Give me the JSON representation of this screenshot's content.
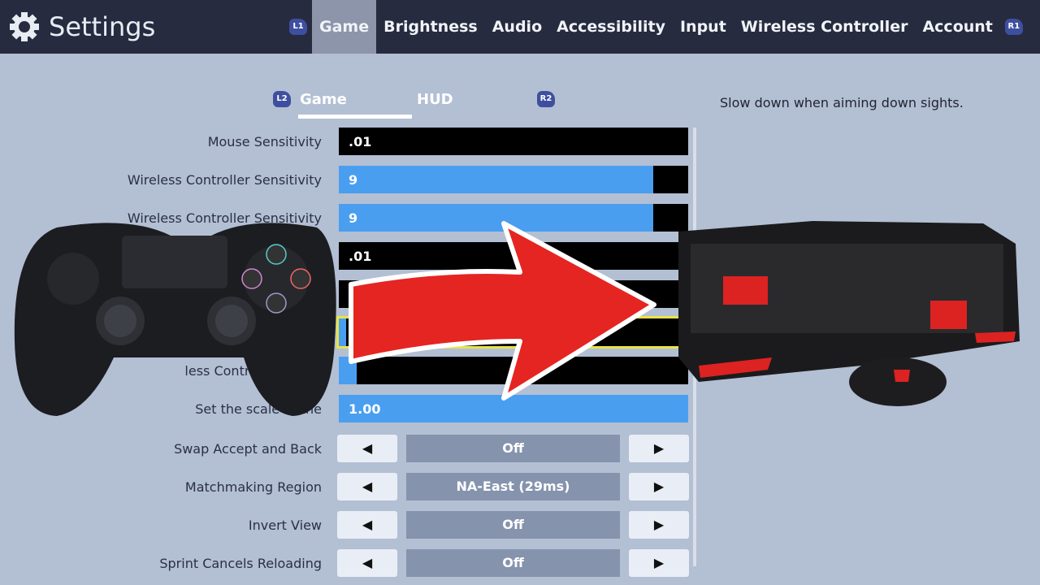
{
  "header": {
    "title": "Settings",
    "left_badge": "L1",
    "right_badge": "R1",
    "tabs": [
      {
        "label": "Game",
        "active": true
      },
      {
        "label": "Brightness"
      },
      {
        "label": "Audio"
      },
      {
        "label": "Accessibility"
      },
      {
        "label": "Input"
      },
      {
        "label": "Wireless Controller"
      },
      {
        "label": "Account"
      }
    ]
  },
  "subtabs": {
    "left_badge": "L2",
    "right_badge": "R2",
    "items": [
      {
        "label": "Game",
        "active": true
      },
      {
        "label": "HUD"
      }
    ]
  },
  "description": "Slow down when aiming down sights.",
  "rows": [
    {
      "label": "Mouse Sensitivity",
      "value": ".01",
      "fill": 0
    },
    {
      "label": "Wireless Controller Sensitivity",
      "value": "9",
      "fill": 0.9
    },
    {
      "label": "Wireless Controller Sensitivity",
      "value": "9",
      "fill": 0.9
    },
    {
      "label": "y",
      "value": ".01",
      "fill": 0
    },
    {
      "label": "",
      "value": ".",
      "fill": 0
    },
    {
      "label": "",
      "value": "",
      "fill": 0.02,
      "selected": true
    },
    {
      "label": "less Controller Scope",
      "value": "",
      "fill": 0.05
    },
    {
      "label": "Set the scale of the",
      "value": "1.00",
      "fill": 1
    }
  ],
  "options": [
    {
      "label": "Swap Accept and Back",
      "value": "Off"
    },
    {
      "label": "Matchmaking Region",
      "value": "NA-East (29ms)"
    },
    {
      "label": "Invert View",
      "value": "Off"
    },
    {
      "label": "Sprint Cancels Reloading",
      "value": "Off"
    }
  ],
  "arrows": {
    "left": "◀",
    "right": "▶"
  },
  "colors": {
    "header": "#262b3f",
    "background": "#b3bfd3",
    "slider_fill": "#4a9ef0",
    "selected_outline": "#e9e34a",
    "arrow": "#e52521"
  }
}
